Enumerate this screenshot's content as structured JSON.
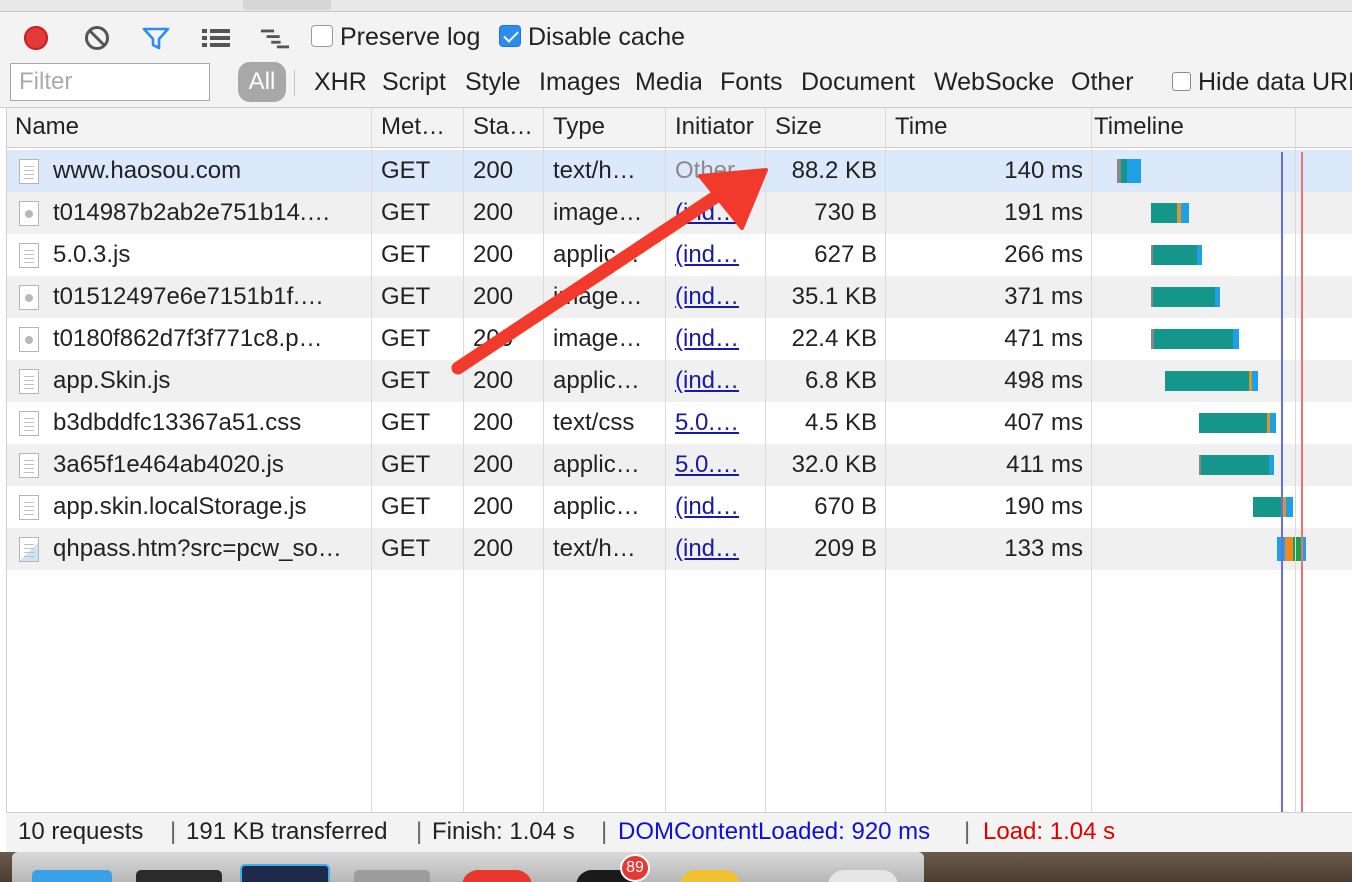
{
  "toolbar": {
    "preserve_log_label": "Preserve log",
    "preserve_log_checked": false,
    "disable_cache_label": "Disable cache",
    "disable_cache_checked": true
  },
  "filter": {
    "placeholder": "Filter",
    "all_label": "All",
    "types": [
      "XHR",
      "Script",
      "Style",
      "Images",
      "Media",
      "Fonts",
      "Document",
      "WebSocket",
      "Other"
    ],
    "hide_data_label": "Hide data URLs"
  },
  "columns": [
    "Name",
    "Method",
    "Status",
    "Type",
    "Initiator",
    "Size",
    "Time",
    "Timeline"
  ],
  "rows": [
    {
      "name": "www.haosou.com",
      "method": "GET",
      "status": "200",
      "type": "text/h…",
      "initiator": "Other",
      "initiator_kind": "other",
      "size": "88.2 KB",
      "time": "140 ms",
      "icon": "document-icon"
    },
    {
      "name": "t014987b2ab2e751b14.…",
      "method": "GET",
      "status": "200",
      "type": "image…",
      "initiator": "(ind…",
      "initiator_kind": "link",
      "size": "730 B",
      "time": "191 ms",
      "icon": "image-icon"
    },
    {
      "name": "5.0.3.js",
      "method": "GET",
      "status": "200",
      "type": "applic…",
      "initiator": "(ind…",
      "initiator_kind": "link",
      "size": "627 B",
      "time": "266 ms",
      "icon": "file-icon"
    },
    {
      "name": "t01512497e6e7151b1f.…",
      "method": "GET",
      "status": "200",
      "type": "image…",
      "initiator": "(ind…",
      "initiator_kind": "link",
      "size": "35.1 KB",
      "time": "371 ms",
      "icon": "image-icon"
    },
    {
      "name": "t0180f862d7f3f771c8.p…",
      "method": "GET",
      "status": "200",
      "type": "image…",
      "initiator": "(ind…",
      "initiator_kind": "link",
      "size": "22.4 KB",
      "time": "471 ms",
      "icon": "image-icon"
    },
    {
      "name": "app.Skin.js",
      "method": "GET",
      "status": "200",
      "type": "applic…",
      "initiator": "(ind…",
      "initiator_kind": "link",
      "size": "6.8 KB",
      "time": "498 ms",
      "icon": "file-icon"
    },
    {
      "name": "b3dbddfc13367a51.css",
      "method": "GET",
      "status": "200",
      "type": "text/css",
      "initiator": "5.0.…",
      "initiator_kind": "link",
      "size": "4.5 KB",
      "time": "407 ms",
      "icon": "file-icon"
    },
    {
      "name": "3a65f1e464ab4020.js",
      "method": "GET",
      "status": "200",
      "type": "applic…",
      "initiator": "5.0.…",
      "initiator_kind": "link",
      "size": "32.0 KB",
      "time": "411 ms",
      "icon": "file-icon"
    },
    {
      "name": "app.skin.localStorage.js",
      "method": "GET",
      "status": "200",
      "type": "applic…",
      "initiator": "(ind…",
      "initiator_kind": "link",
      "size": "670 B",
      "time": "190 ms",
      "icon": "file-icon"
    },
    {
      "name": "qhpass.htm?src=pcw_so…",
      "method": "GET",
      "status": "200",
      "type": "text/h…",
      "initiator": "(ind…",
      "initiator_kind": "link",
      "size": "209 B",
      "time": "133 ms",
      "icon": "document-icon"
    }
  ],
  "status_bar": {
    "requests": "10 requests",
    "transferred": "191 KB transferred",
    "finish": "Finish: 1.04 s",
    "dom_content_loaded": "DOMContentLoaded: 920 ms",
    "load": "Load: 1.04 s",
    "separator": "|"
  },
  "dock": {
    "badge": "89"
  },
  "colors": {
    "record": "#e53a3a",
    "dom_loaded": "#1010d0",
    "load": "#e00000",
    "bar_receive": "#14968a",
    "bar_send": "#1ea0e8",
    "annotation_arrow": "#f23a2c"
  }
}
